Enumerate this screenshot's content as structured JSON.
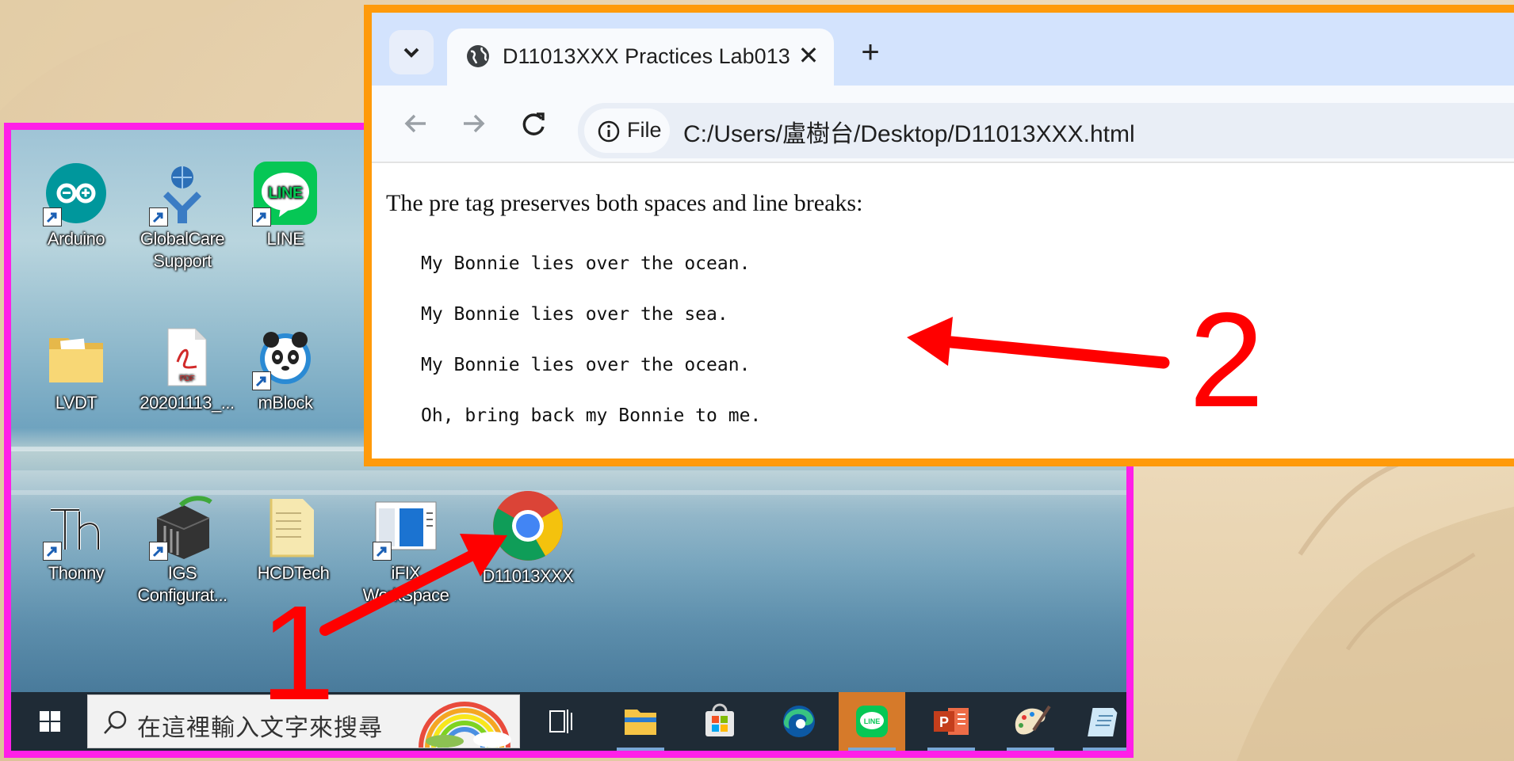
{
  "desktop": {
    "icons": [
      {
        "label": "Arduino",
        "shortcut": true
      },
      {
        "label": "GlobalCare Support",
        "shortcut": true
      },
      {
        "label": "LINE",
        "shortcut": true
      },
      {
        "label": "LVDT",
        "shortcut": false
      },
      {
        "label": "20201113_...",
        "shortcut": false
      },
      {
        "label": "mBlock",
        "shortcut": true
      },
      {
        "label": "Thonny",
        "shortcut": true
      },
      {
        "label": "IGS Configurat...",
        "shortcut": true
      },
      {
        "label": "HCDTech",
        "shortcut": false
      },
      {
        "label": "iFIX WorkSpace",
        "shortcut": true
      },
      {
        "label": "D11013XXX",
        "shortcut": false
      }
    ]
  },
  "taskbar": {
    "search_placeholder": "在這裡輸入文字來搜尋",
    "apps": [
      "task-view",
      "file-explorer",
      "microsoft-store",
      "edge",
      "line",
      "powerpoint",
      "paint",
      "notepad"
    ]
  },
  "browser": {
    "tab_title": "D11013XXX Practices Lab013",
    "tab_close": "✕",
    "new_tab": "+",
    "site_chip": "File",
    "url": "C:/Users/盧樹台/Desktop/D11013XXX.html",
    "page": {
      "intro": "The pre tag preserves both spaces and line breaks:",
      "pre_lines": [
        "My Bonnie lies over the ocean.",
        "My Bonnie lies over the sea.",
        "My Bonnie lies over the ocean.",
        "Oh, bring back my Bonnie to me."
      ]
    }
  },
  "annotations": {
    "step1": "1",
    "step2": "2",
    "color": "#ff0000",
    "frame_desktop_color": "#ff1fe8",
    "frame_browser_color": "#ff9a0a"
  }
}
